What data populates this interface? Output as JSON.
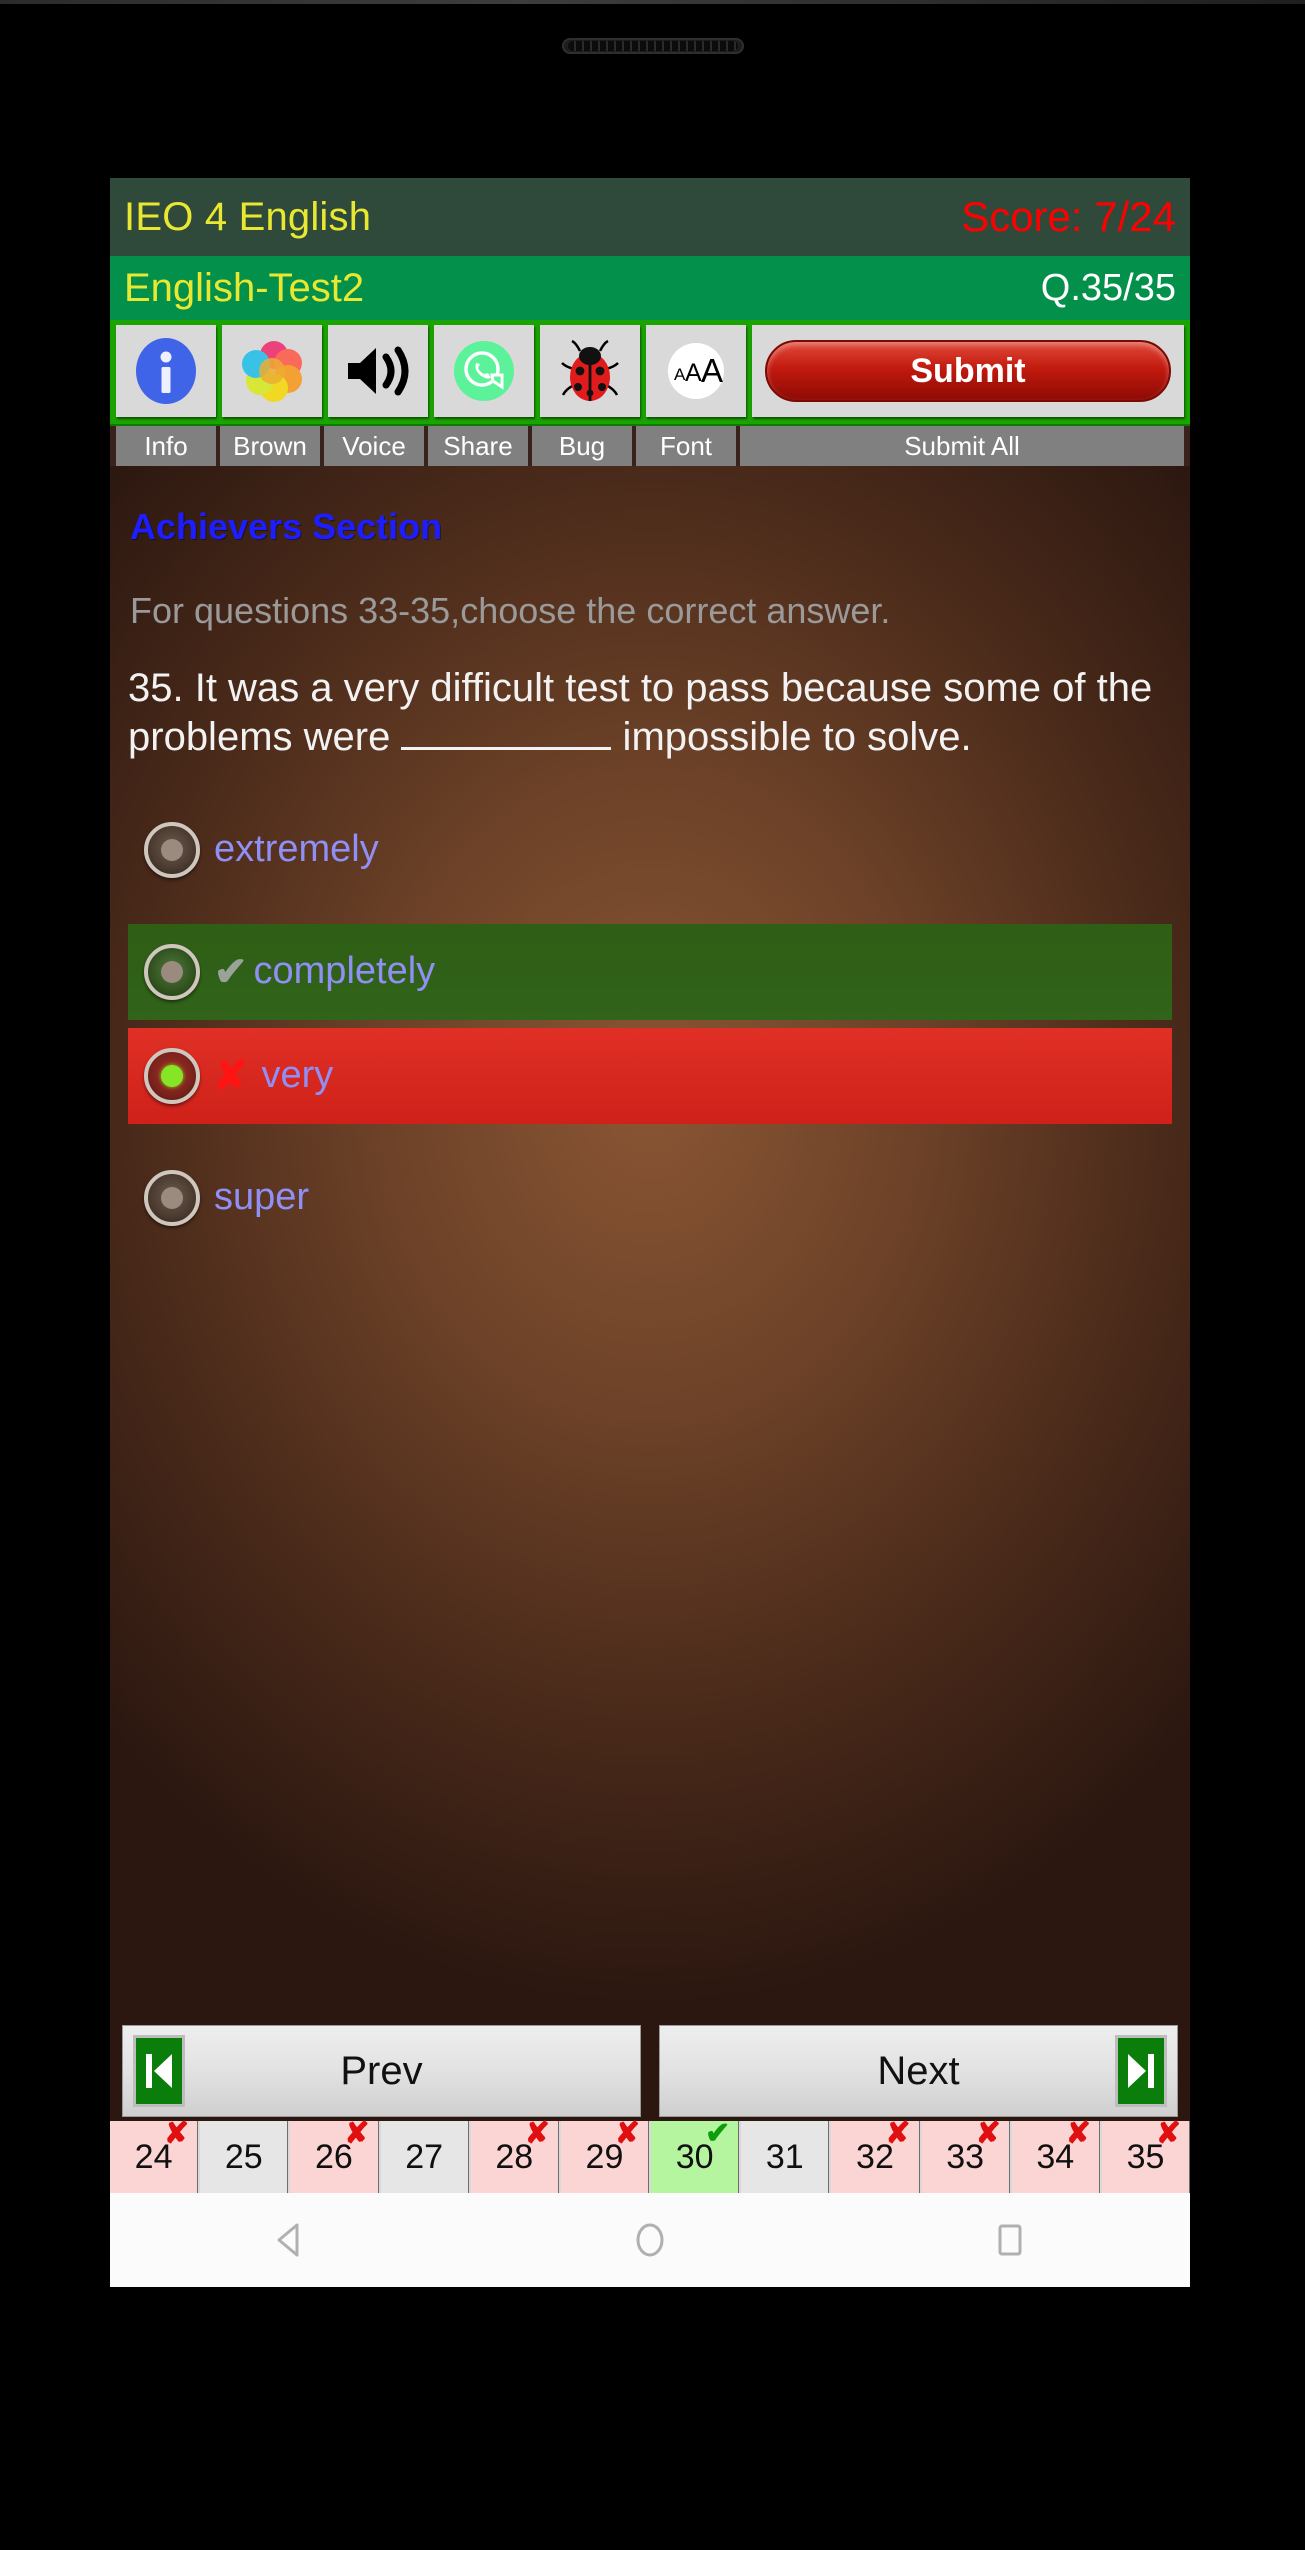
{
  "header": {
    "app_title": "IEO 4 English",
    "score": "Score: 7/24",
    "test_name": "English-Test2",
    "question_counter": "Q.35/35",
    "title_color": "#e8e832",
    "score_color": "#ff0000"
  },
  "toolbar": {
    "items": [
      {
        "label": "Info",
        "icon": "info-icon"
      },
      {
        "label": "Brown",
        "icon": "color-palette-icon"
      },
      {
        "label": "Voice",
        "icon": "speaker-volume-icon"
      },
      {
        "label": "Share",
        "icon": "whatsapp-share-icon"
      },
      {
        "label": "Bug",
        "icon": "ladybug-icon"
      },
      {
        "label": "Font",
        "icon": "font-size-icon"
      },
      {
        "label": "Submit All",
        "icon": "submit-button-icon"
      }
    ],
    "submit_label": "Submit"
  },
  "content": {
    "section_title": "Achievers Section",
    "instruction": "For questions 33-35,choose the correct answer.",
    "question_part1": "35. It was a very difficult test to pass because some of the problems were ",
    "question_part2": " impossible to solve.",
    "options": [
      {
        "label": "extremely",
        "state": "normal",
        "mark": "",
        "selected": false
      },
      {
        "label": "completely",
        "state": "correct",
        "mark": "✔",
        "selected": false
      },
      {
        "label": "very",
        "state": "wrong",
        "mark": "✘",
        "selected": true
      },
      {
        "label": "super",
        "state": "normal",
        "mark": "",
        "selected": false
      }
    ]
  },
  "navigation": {
    "prev_label": "Prev",
    "next_label": "Next"
  },
  "question_strip": [
    {
      "number": "24",
      "status": "wrong"
    },
    {
      "number": "25",
      "status": "none"
    },
    {
      "number": "26",
      "status": "wrong"
    },
    {
      "number": "27",
      "status": "none"
    },
    {
      "number": "28",
      "status": "wrong"
    },
    {
      "number": "29",
      "status": "wrong"
    },
    {
      "number": "30",
      "status": "correct"
    },
    {
      "number": "31",
      "status": "none"
    },
    {
      "number": "32",
      "status": "wrong"
    },
    {
      "number": "33",
      "status": "wrong"
    },
    {
      "number": "34",
      "status": "wrong"
    },
    {
      "number": "35",
      "status": "wrong"
    }
  ],
  "android_nav": {
    "back": "back-triangle-icon",
    "home": "home-circle-icon",
    "recents": "recents-square-icon"
  }
}
